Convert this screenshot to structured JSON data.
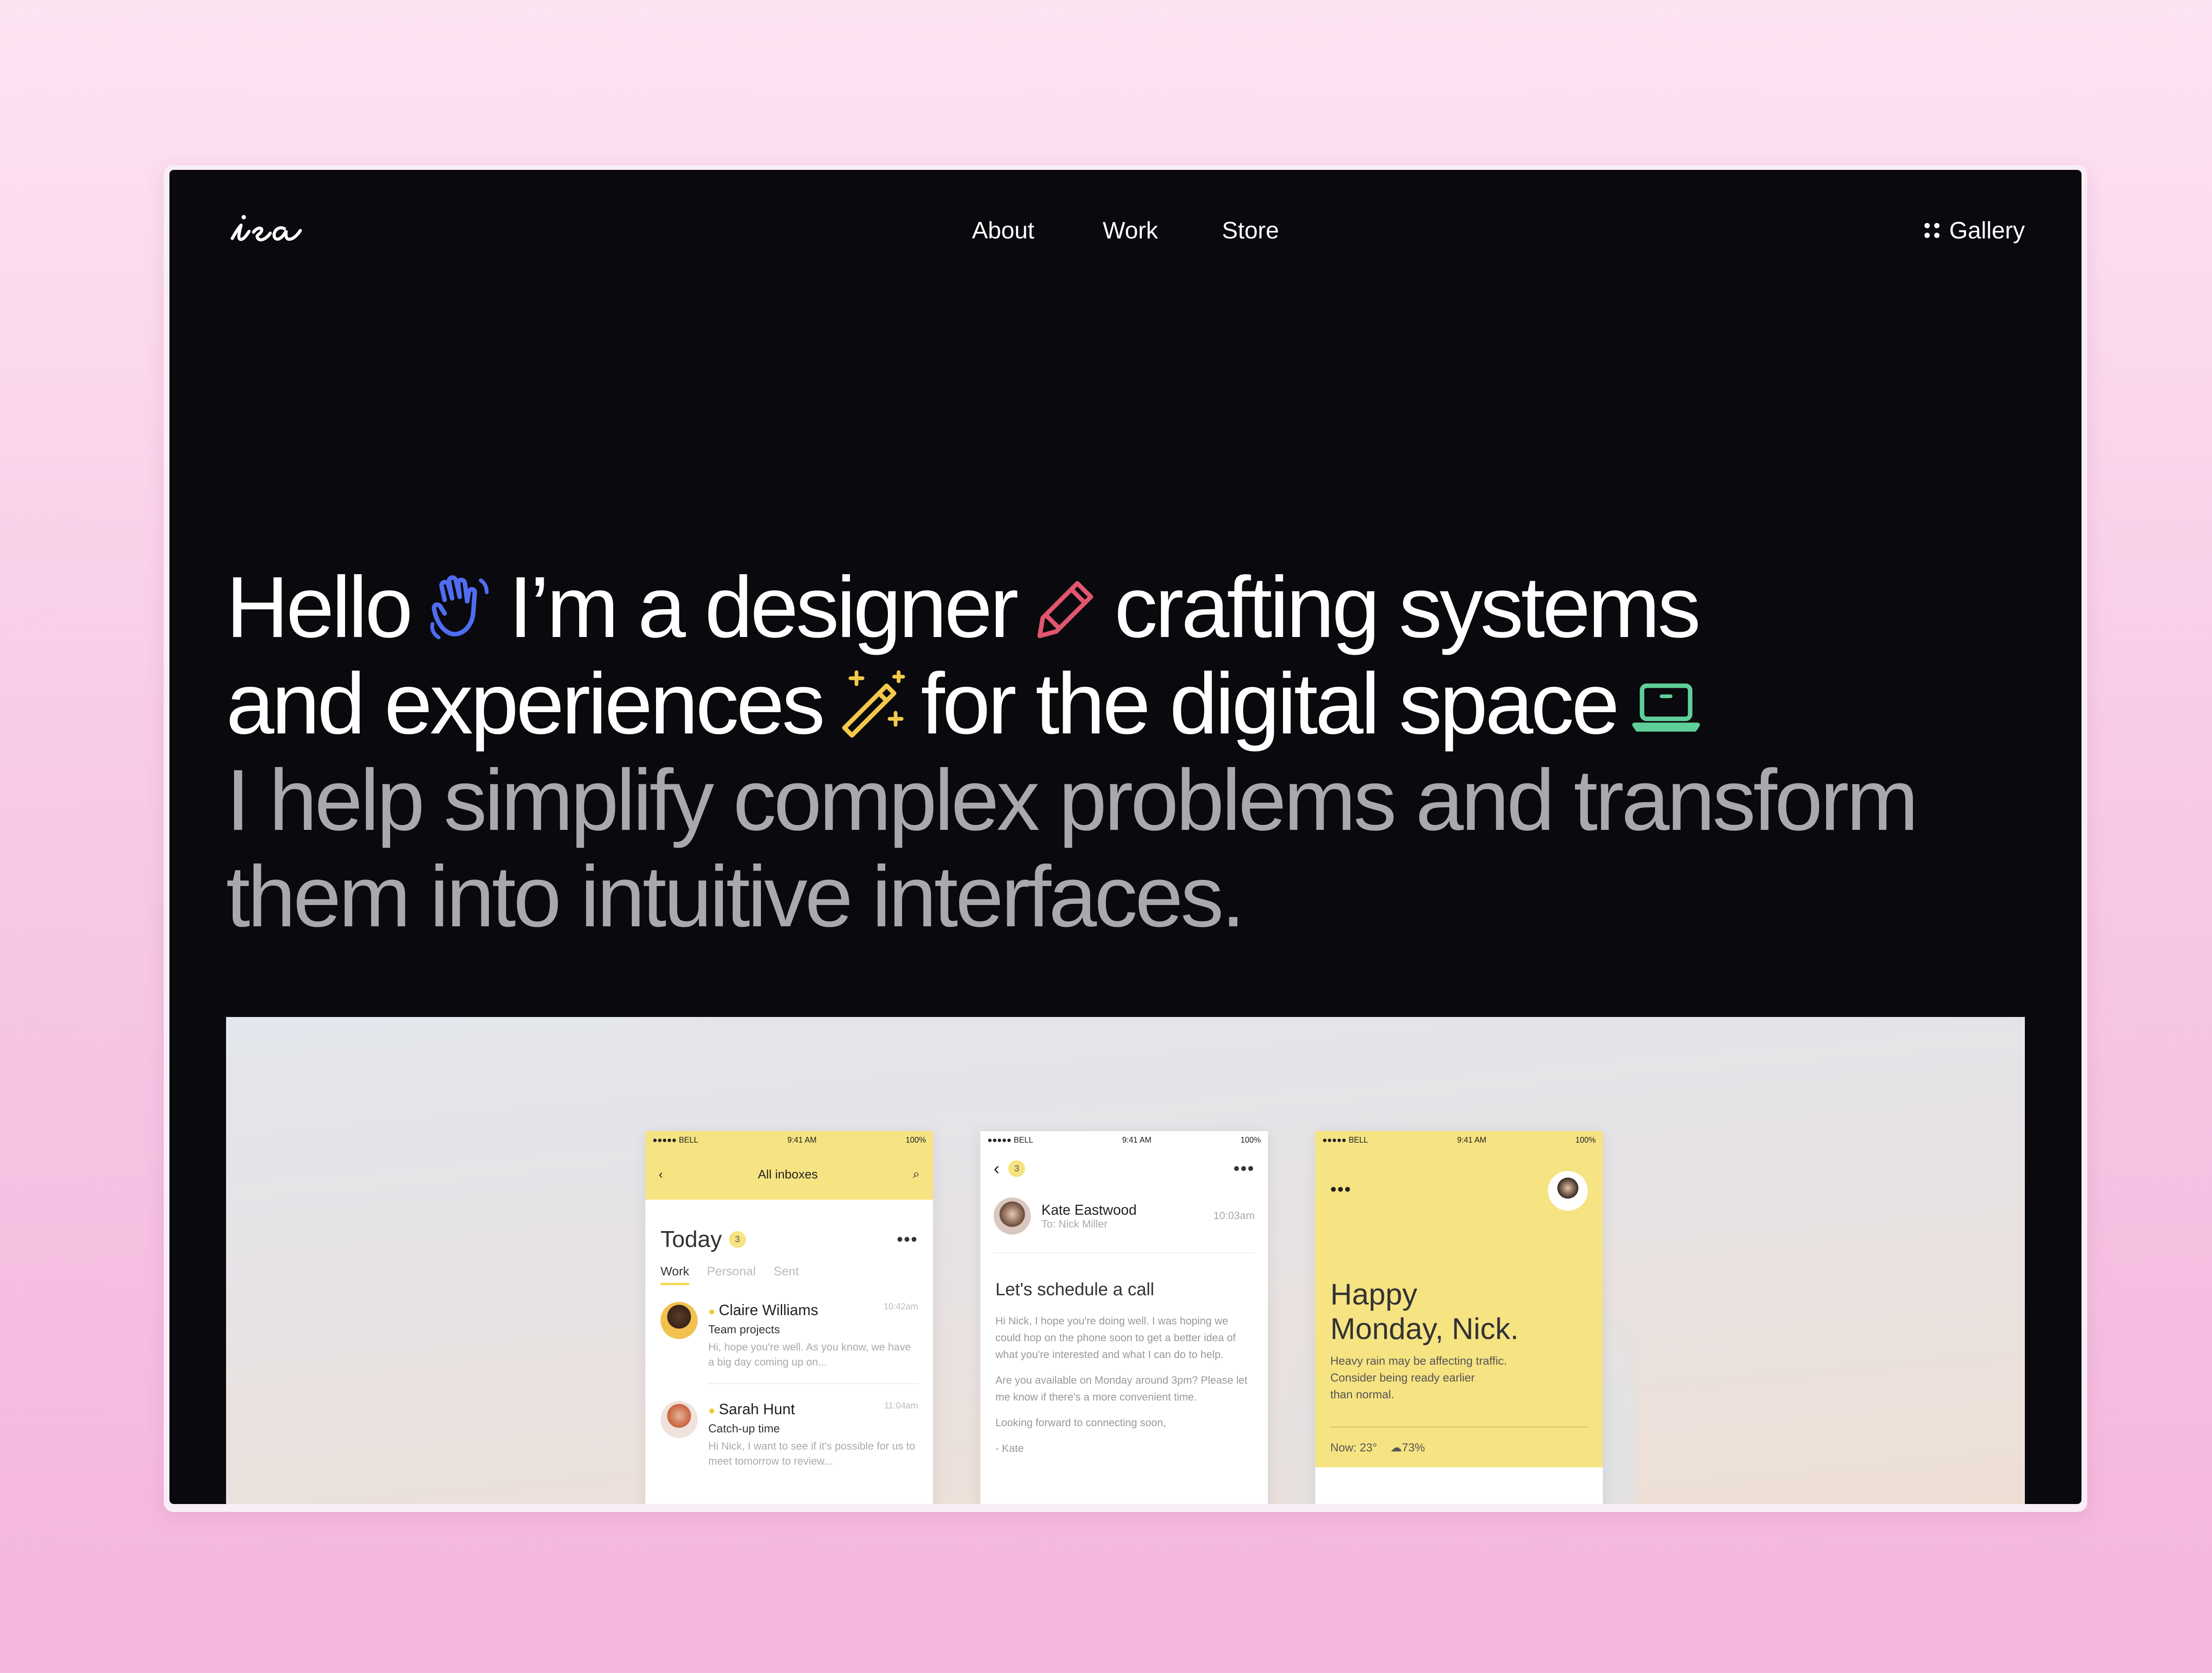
{
  "brand": {
    "logo_text": "isa"
  },
  "nav": {
    "links": [
      "About",
      "Work",
      "Store"
    ],
    "gallery_label": "Gallery"
  },
  "hero": {
    "line1a": "Hello",
    "line1b": "I’m a designer",
    "line1c": "crafting systems",
    "line2a": "and experiences",
    "line2b": "for the digital space",
    "line3": "I help simplify complex problems and transform",
    "line4": "them into intuitive interfaces.",
    "icons": [
      "waving-hand-icon",
      "pencil-icon",
      "magic-wand-icon",
      "laptop-icon"
    ]
  },
  "colors": {
    "background": "#0a090d",
    "hand": "#4e6df0",
    "pencil": "#e0566e",
    "wand": "#f3c94a",
    "laptop": "#5fcf9a",
    "mock_yellow": "#f6e382"
  },
  "mock": {
    "status": {
      "carrier": "●●●●● BELL",
      "time": "9:41 AM",
      "battery": "100%"
    },
    "inbox": {
      "title": "All inboxes",
      "heading": "Today",
      "badge": "3",
      "tabs": [
        "Work",
        "Personal",
        "Sent"
      ],
      "mails": [
        {
          "name": "Claire Williams",
          "time": "10:42am",
          "subject": "Team projects",
          "preview": "Hi, hope you're well. As you know, we have a big day coming up on..."
        },
        {
          "name": "Sarah Hunt",
          "time": "11:04am",
          "subject": "Catch-up time",
          "preview": "Hi Nick, I want to see if it's possible for us to meet tomorrow to review..."
        }
      ]
    },
    "detail": {
      "badge": "3",
      "sender": "Kate Eastwood",
      "to": "To: Nick Miller",
      "time": "10:03am",
      "subject": "Let's schedule a call",
      "p1": "Hi Nick, I hope you're doing well. I was hoping we could hop on the phone soon to get a better idea of what you're interested and what I can do to help.",
      "p2": "Are you available on Monday around 3pm? Please let me know if there's a more convenient time.",
      "p3": "Looking forward to connecting soon,",
      "p4": "- Kate"
    },
    "greeting": {
      "line1": "Happy",
      "line2": "Monday, Nick.",
      "note1": "Heavy rain may be affecting traffic.",
      "note2": "Consider being ready earlier",
      "note3": "than normal.",
      "now": "Now: 23°",
      "forecast": "73%"
    }
  }
}
